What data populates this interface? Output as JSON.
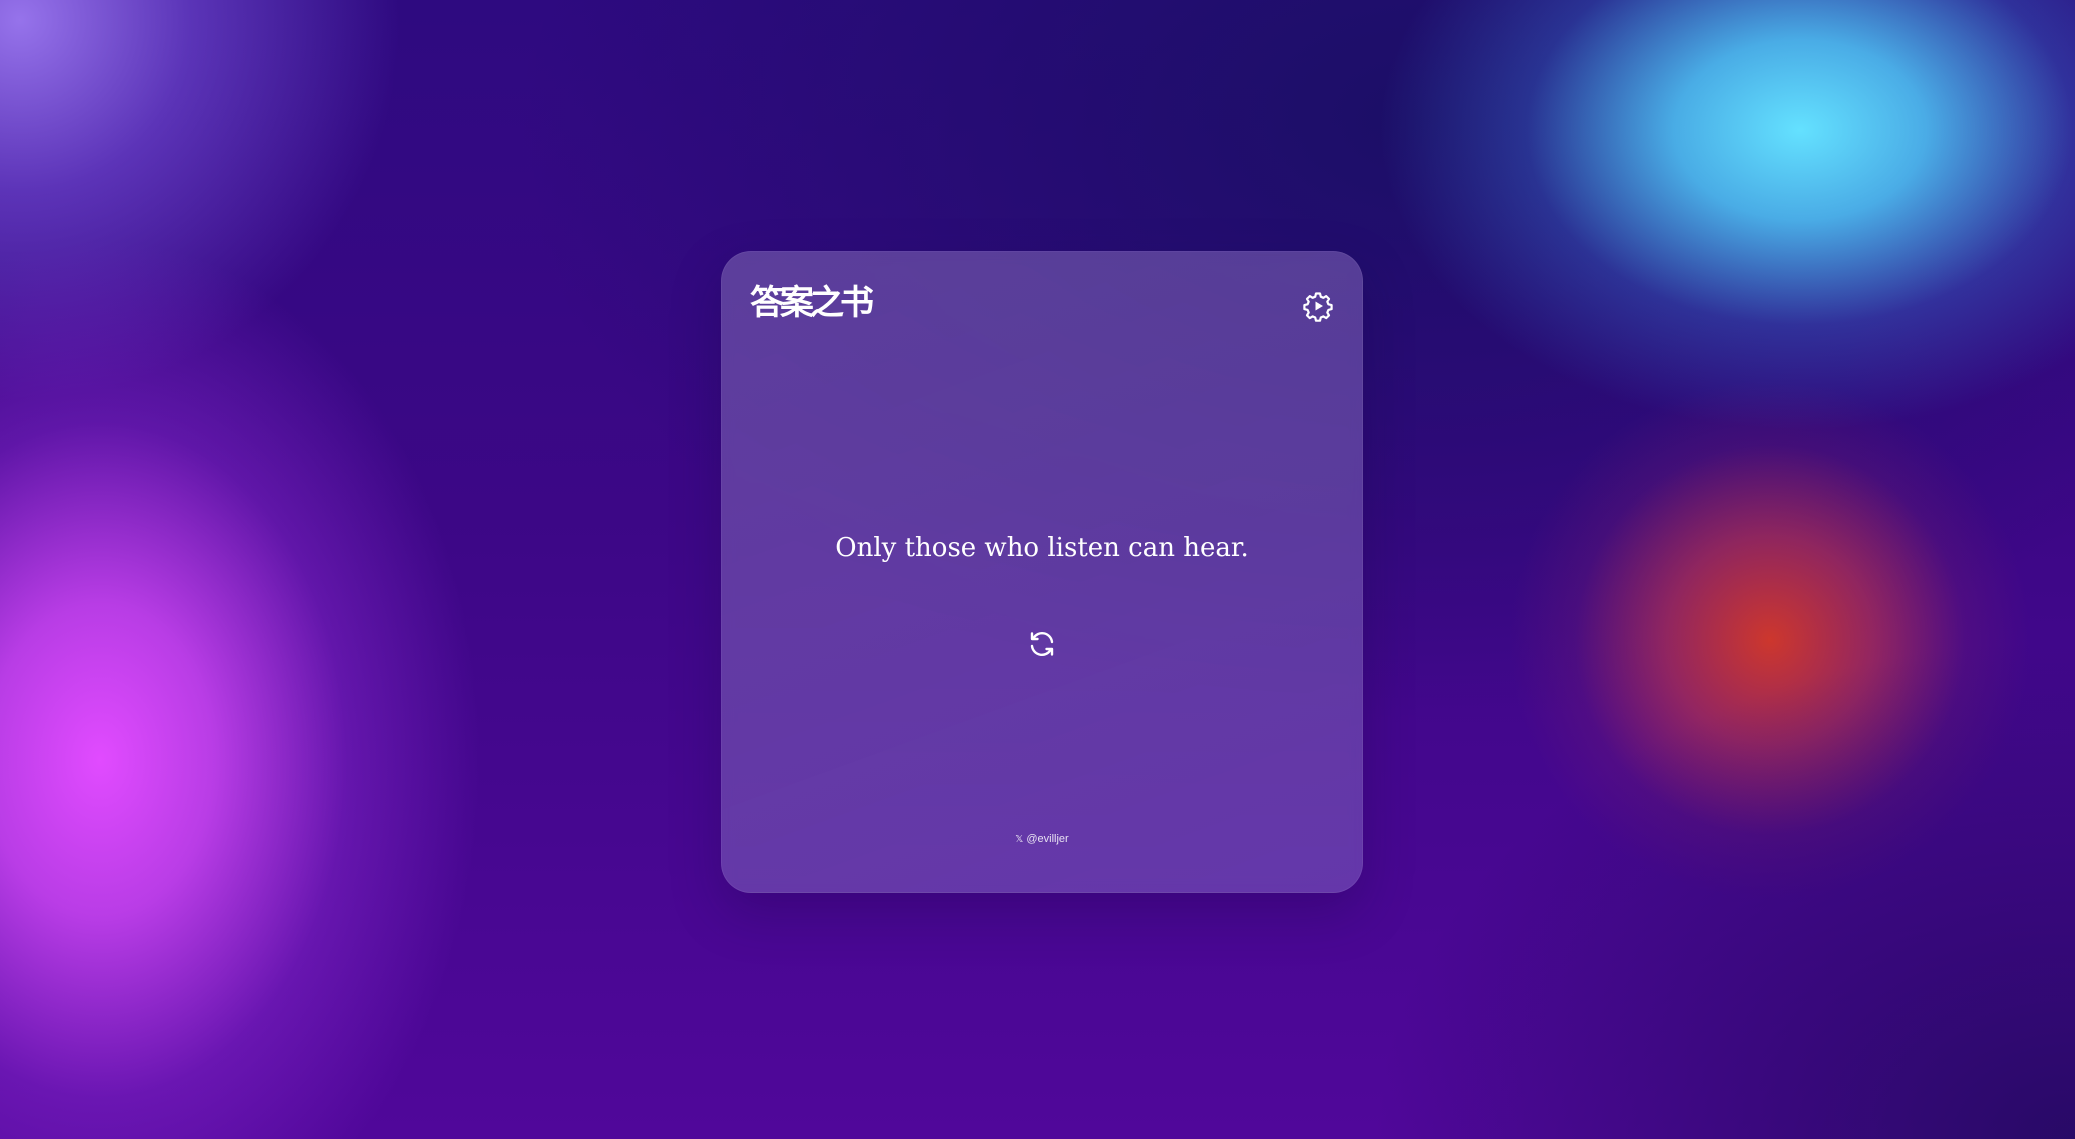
{
  "app": {
    "logo_text": "答案之书"
  },
  "card": {
    "answer": "Only those who listen can hear.",
    "footer_icon_glyph": "𝕏",
    "footer_handle": "@evilljer"
  },
  "icons": {
    "settings": "settings-play-gear-icon",
    "refresh": "refresh-icon",
    "social": "x-logo-icon"
  },
  "colors": {
    "card_tint": "#7a5fb0",
    "text": "#ffffff",
    "bg_cyan": "#64e1ff",
    "bg_magenta": "#e14bff",
    "bg_red": "#cd372d",
    "bg_base": "#2e0a80"
  }
}
